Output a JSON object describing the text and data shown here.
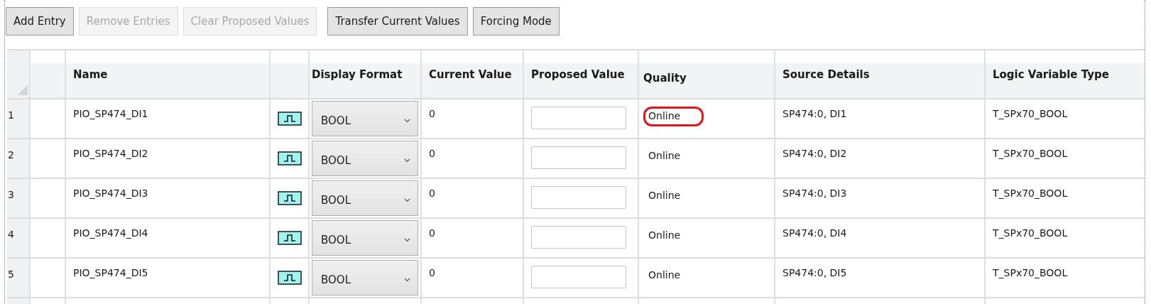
{
  "toolbar": {
    "buttons": [
      {
        "label": "Add Entry",
        "disabled": false
      },
      {
        "label": "Remove Entries",
        "disabled": true
      },
      {
        "label": "Clear Proposed Values",
        "disabled": true
      },
      {
        "label": "Transfer Current Values",
        "disabled": false
      },
      {
        "label": "Forcing Mode",
        "disabled": false
      }
    ]
  },
  "table": {
    "columns": [
      "Name",
      "Display Format",
      "Current Value",
      "Proposed Value",
      "Quality",
      "Source Details",
      "Logic Variable Type"
    ],
    "rows": [
      {
        "number": "1",
        "name": "PIO_SP474_DI1",
        "display_format": "BOOL",
        "current_value": "0",
        "quality": "Online",
        "quality_highlighted": true,
        "source_details": "SP474:0, DI1",
        "logic_variable_type": "T_SPx70_BOOL"
      },
      {
        "number": "2",
        "name": "PIO_SP474_DI2",
        "display_format": "BOOL",
        "current_value": "0",
        "quality": "Online",
        "quality_highlighted": false,
        "source_details": "SP474:0, DI2",
        "logic_variable_type": "T_SPx70_BOOL"
      },
      {
        "number": "3",
        "name": "PIO_SP474_DI3",
        "display_format": "BOOL",
        "current_value": "0",
        "quality": "Online",
        "quality_highlighted": false,
        "source_details": "SP474:0, DI3",
        "logic_variable_type": "T_SPx70_BOOL"
      },
      {
        "number": "4",
        "name": "PIO_SP474_DI4",
        "display_format": "BOOL",
        "current_value": "0",
        "quality": "Online",
        "quality_highlighted": false,
        "source_details": "SP474:0, DI4",
        "logic_variable_type": "T_SPx70_BOOL"
      },
      {
        "number": "5",
        "name": "PIO_SP474_DI5",
        "display_format": "BOOL",
        "current_value": "0",
        "quality": "Online",
        "quality_highlighted": false,
        "source_details": "SP474:0, DI5",
        "logic_variable_type": "T_SPx70_BOOL"
      }
    ]
  }
}
